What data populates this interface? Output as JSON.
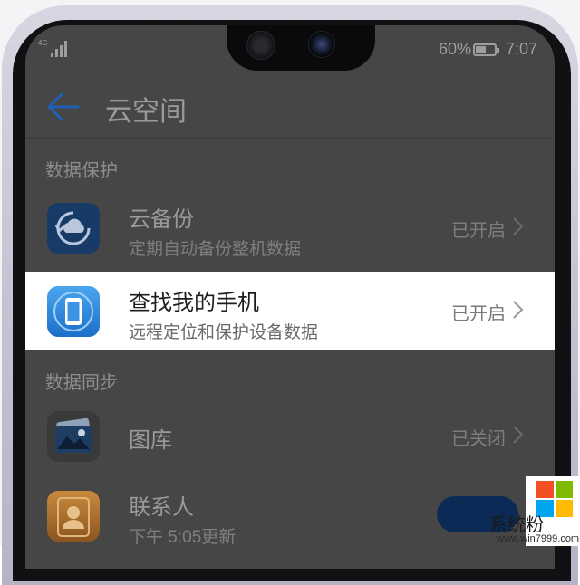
{
  "status_bar": {
    "network": "4G",
    "battery_text": "60%",
    "battery_level": 0.6,
    "time": "7:07"
  },
  "header": {
    "title": "云空间"
  },
  "sections": [
    {
      "title": "数据保护",
      "items": [
        {
          "title": "云备份",
          "subtitle": "定期自动备份整机数据",
          "status": "已开启",
          "icon": "cloud-backup-icon"
        },
        {
          "title": "查找我的手机",
          "subtitle": "远程定位和保护设备数据",
          "status": "已开启",
          "icon": "find-my-phone-icon"
        }
      ]
    },
    {
      "title": "数据同步",
      "items": [
        {
          "title": "图库",
          "status": "已关闭",
          "icon": "gallery-icon"
        },
        {
          "title": "联系人",
          "subtitle": "下午 5:05更新",
          "icon": "contacts-icon",
          "toggle_on": true
        }
      ]
    }
  ],
  "watermark": {
    "text": "系统粉",
    "url": "www.win7999.com"
  },
  "colors": {
    "accent": "#1f5fb6",
    "screen_bg": "#464646",
    "highlight_bg": "#ffffff"
  }
}
